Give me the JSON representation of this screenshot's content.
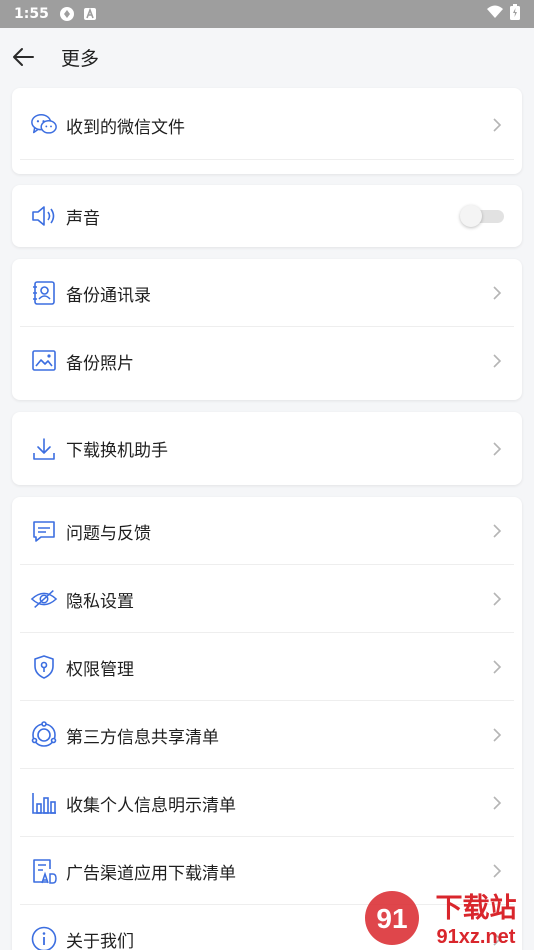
{
  "status_bar": {
    "time": "1:55"
  },
  "header": {
    "title": "更多"
  },
  "groups": [
    {
      "items": [
        {
          "label": "收到的微信文件"
        }
      ]
    },
    {
      "items": [
        {
          "label": "声音",
          "toggle_on": false
        }
      ]
    },
    {
      "items": [
        {
          "label": "备份通讯录"
        },
        {
          "label": "备份照片"
        }
      ]
    },
    {
      "items": [
        {
          "label": "下载换机助手"
        }
      ]
    },
    {
      "items": [
        {
          "label": "问题与反馈"
        },
        {
          "label": "隐私设置"
        },
        {
          "label": "权限管理"
        },
        {
          "label": "第三方信息共享清单"
        },
        {
          "label": "收集个人信息明示清单"
        },
        {
          "label": "广告渠道应用下载清单"
        },
        {
          "label": "关于我们"
        }
      ]
    }
  ],
  "watermark": {
    "brand": "下载站",
    "site": "91xz.net",
    "logo_mark": "91"
  },
  "colors": {
    "icon_blue": "#3c6ee0",
    "chevron": "#b5b5b5",
    "status_bar": "#9e9e9e",
    "watermark_red": "#d9262c"
  },
  "icons": [
    "wechat-file-icon",
    "speaker-icon",
    "contacts-icon",
    "photo-icon",
    "download-icon",
    "feedback-icon",
    "privacy-eye-icon",
    "shield-icon",
    "share-icon",
    "chart-icon",
    "ad-list-icon",
    "info-icon"
  ]
}
